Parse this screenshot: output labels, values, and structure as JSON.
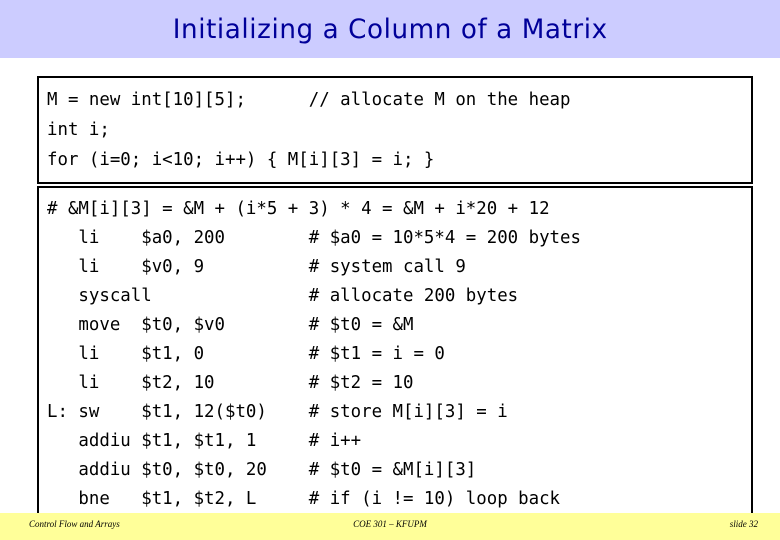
{
  "slide": {
    "title": "Initializing a Column of a Matrix",
    "title_bg_color": "#ccccff",
    "title_text_color": "#000099",
    "footer_bg_color": "#ffff99"
  },
  "c_code_box": {
    "lines": [
      "M = new int[10][5];      // allocate M on the heap",
      "int i;",
      "for (i=0; i<10; i++) { M[i][3] = i; }"
    ]
  },
  "asm_code_box": {
    "lines": [
      "# &M[i][3] = &M + (i*5 + 3) * 4 = &M + i*20 + 12",
      "   li    $a0, 200        # $a0 = 10*5*4 = 200 bytes",
      "   li    $v0, 9          # system call 9",
      "   syscall               # allocate 200 bytes",
      "   move  $t0, $v0        # $t0 = &M",
      "   li    $t1, 0          # $t1 = i = 0",
      "   li    $t2, 10         # $t2 = 10",
      "L: sw    $t1, 12($t0)    # store M[i][3] = i",
      "   addiu $t1, $t1, 1     # i++",
      "   addiu $t0, $t0, 20    # $t0 = &M[i][3]",
      "   bne   $t1, $t2, L     # if (i != 10) loop back"
    ]
  },
  "footer": {
    "left": "Control Flow and Arrays",
    "center": "COE 301 – KFUPM",
    "right": "slide 32"
  }
}
